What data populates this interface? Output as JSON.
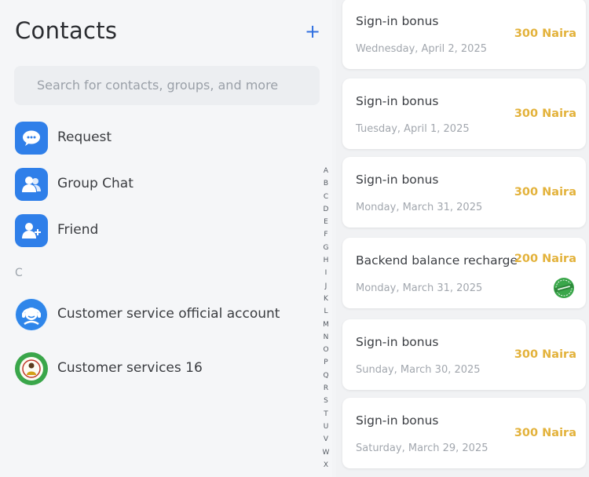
{
  "contacts": {
    "title": "Contacts",
    "add_icon": "plus-icon",
    "search_placeholder": "Search for contacts, groups, and more",
    "items": [
      {
        "label": "Request",
        "icon": "chat-bubble-icon"
      },
      {
        "label": "Group Chat",
        "icon": "group-icon"
      },
      {
        "label": "Friend",
        "icon": "add-friend-icon"
      }
    ],
    "section_letter": "C",
    "entries": [
      {
        "label": "Customer service official account",
        "icon": "support-agent-icon"
      },
      {
        "label": "Customer services 16",
        "icon": "customer-avatar"
      }
    ],
    "alphabet": [
      "A",
      "B",
      "C",
      "D",
      "E",
      "F",
      "G",
      "H",
      "I",
      "J",
      "K",
      "L",
      "M",
      "N",
      "O",
      "P",
      "Q",
      "R",
      "S",
      "T",
      "U",
      "V",
      "W",
      "X"
    ]
  },
  "transactions": [
    {
      "title": "Sign-in bonus",
      "date": "Wednesday, April 2, 2025",
      "amount": "300 Naira"
    },
    {
      "title": "Sign-in bonus",
      "date": "Tuesday, April 1, 2025",
      "amount": "300 Naira"
    },
    {
      "title": "Sign-in bonus",
      "date": "Monday, March 31, 2025",
      "amount": "300 Naira"
    },
    {
      "title": "Backend balance recharge",
      "date": "Monday, March 31, 2025",
      "amount": "200 Naira",
      "stamp": "approved-stamp-icon"
    },
    {
      "title": "Sign-in bonus",
      "date": "Sunday, March 30, 2025",
      "amount": "300 Naira"
    },
    {
      "title": "Sign-in bonus",
      "date": "Saturday, March 29, 2025",
      "amount": "300 Naira"
    }
  ],
  "colors": {
    "accent": "#2f7fe9",
    "amount": "#e3b23b",
    "stamp": "#3aa64a"
  }
}
